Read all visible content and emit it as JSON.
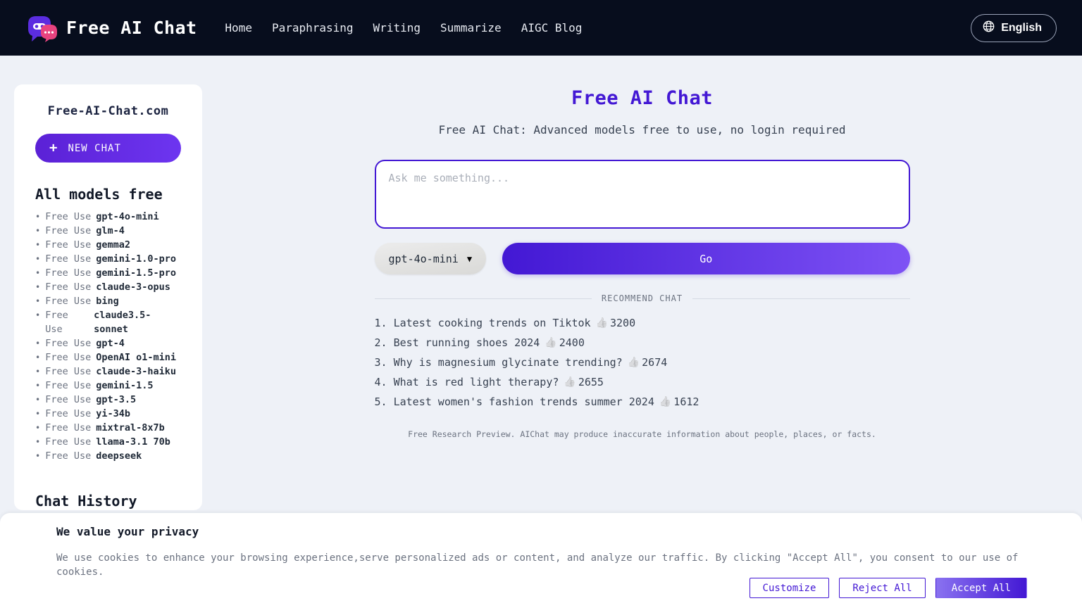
{
  "header": {
    "brand": "Free AI Chat",
    "logo_icon": "chat-bubbles-logo",
    "nav": [
      {
        "label": "Home"
      },
      {
        "label": "Paraphrasing"
      },
      {
        "label": "Writing"
      },
      {
        "label": "Summarize"
      },
      {
        "label": "AIGC Blog"
      }
    ],
    "language": {
      "label": "English",
      "icon": "globe-icon"
    },
    "bg_color": "#070d1d"
  },
  "sidebar": {
    "site_title": "Free-AI-Chat.com",
    "new_chat": {
      "label": "NEW CHAT",
      "icon": "plus-icon"
    },
    "models_heading": "All models free",
    "free_use_prefix": "Free Use",
    "models": [
      "gpt-4o-mini",
      "glm-4",
      "gemma2",
      "gemini-1.0-pro",
      "gemini-1.5-pro",
      "claude-3-opus",
      "bing",
      "claude3.5-sonnet",
      "gpt-4",
      "OpenAI o1-mini",
      "claude-3-haiku",
      "gemini-1.5",
      "gpt-3.5",
      "yi-34b",
      "mixtral-8x7b",
      "llama-3.1 70b",
      "deepseek"
    ],
    "history_heading": "Chat History"
  },
  "main": {
    "title": "Free AI Chat",
    "subtitle": "Free AI Chat: Advanced models free to use, no login required",
    "prompt": {
      "value": "",
      "placeholder": "Ask me something..."
    },
    "model_selector": {
      "value": "gpt-4o-mini",
      "icon": "chevron-down-icon"
    },
    "go_button": "Go",
    "recommend_label": "RECOMMEND CHAT",
    "recommendations": [
      {
        "rank": "1.",
        "text": "Latest cooking trends on Tiktok",
        "likes": "3200"
      },
      {
        "rank": "2.",
        "text": "Best running shoes 2024",
        "likes": "2400"
      },
      {
        "rank": "3.",
        "text": "Why is magnesium glycinate trending?",
        "likes": "2674"
      },
      {
        "rank": "4.",
        "text": "What is red light therapy?",
        "likes": "2655"
      },
      {
        "rank": "5.",
        "text": "Latest women's fashion trends summer 2024",
        "likes": "1612"
      }
    ],
    "disclaimer": "Free Research Preview. AIChat may produce inaccurate information about people, places, or facts."
  },
  "cookie_banner": {
    "title": "We value your privacy",
    "body": "We use cookies to enhance your browsing experience,serve personalized ads or content, and analyze our traffic. By clicking \"Accept All\", you consent to our use of cookies.",
    "customize": "Customize",
    "reject": "Reject All",
    "accept": "Accept All"
  },
  "colors": {
    "accent": "#4318d4",
    "accent_light": "#7e52f5",
    "page_bg": "#eef1f7",
    "header_bg": "#070d1d",
    "card_bg": "#ffffff"
  }
}
